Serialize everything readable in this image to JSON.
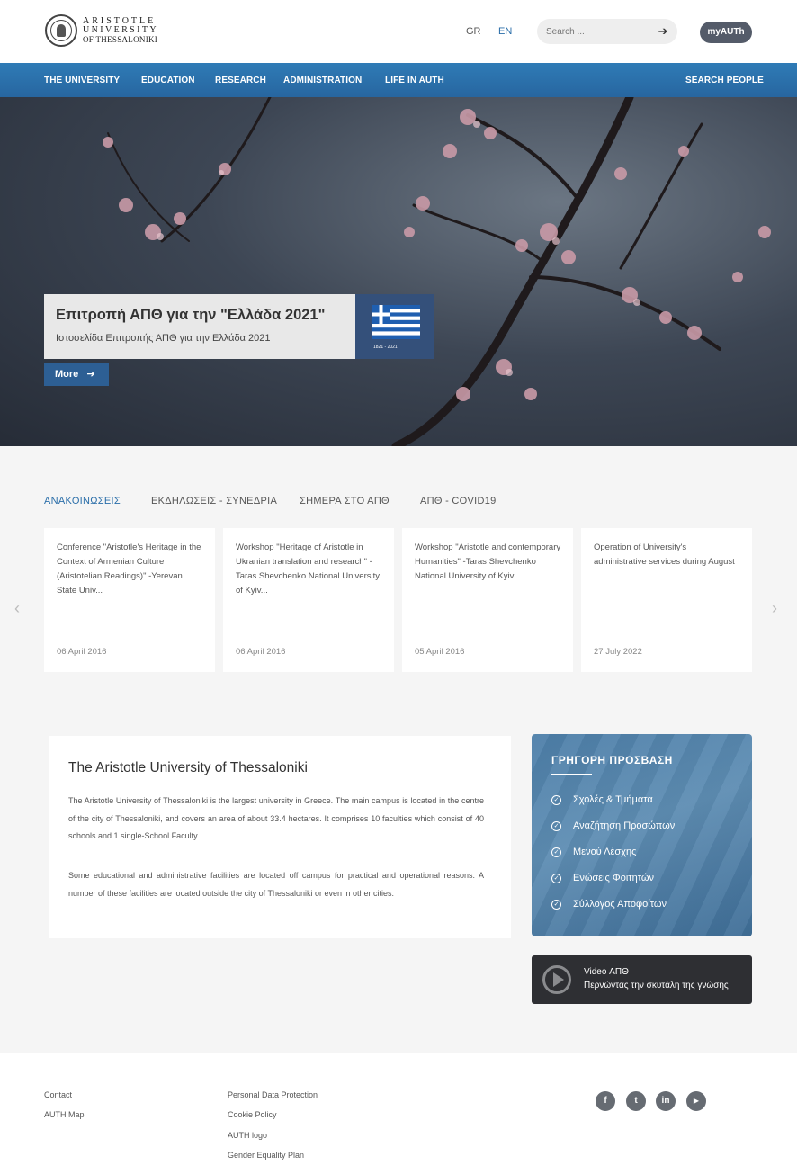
{
  "header": {
    "logo": {
      "line1": "ARISTOTLE",
      "line2": "UNIVERSITY",
      "line3": "OF THESSALONIKI"
    },
    "languages": [
      "GR",
      "EN"
    ],
    "search_placeholder": "Search ...",
    "myauth_label": "myAUTh"
  },
  "nav": {
    "items": [
      "THE UNIVERSITY",
      "EDUCATION",
      "RESEARCH",
      "ADMINISTRATION",
      "LIFE IN AUTH"
    ],
    "search_people": "SEARCH PEOPLE"
  },
  "hero": {
    "title": "Επιτροπή ΑΠΘ για την \"Ελλάδα 2021\"",
    "subtitle": "Ιστοσελίδα Επιτροπής ΑΠΘ για την Ελλάδα 2021",
    "more_label": "More",
    "flag_caption": "1821 - 2021"
  },
  "news": {
    "tabs": [
      "ΑΝΑΚΟΙΝΩΣΕΙΣ",
      "ΕΚΔΗΛΩΣΕΙΣ - ΣΥΝΕΔΡΙΑ",
      "ΣΗΜΕΡΑ ΣΤΟ ΑΠΘ",
      "ΑΠΘ - COVID19"
    ],
    "cards": [
      {
        "title": "Conference \"Aristotle's Heritage in the Context of Armenian Culture (Aristotelian Readings)\" -Yerevan State Univ...",
        "date": "06 April 2016"
      },
      {
        "title": "Workshop \"Heritage of Aristotle in Ukranian translation and research\" -Taras Shevchenko National University of Kyiv...",
        "date": "06 April 2016"
      },
      {
        "title": "Workshop \"Aristotle and contemporary Humanities\" -Taras Shevchenko National University of Kyiv",
        "date": "05 April 2016"
      },
      {
        "title": "Operation of University's administrative services during August",
        "date": "27 July 2022"
      }
    ],
    "prev_arrow": "‹",
    "next_arrow": "›"
  },
  "about": {
    "title": "The Aristotle University of Thessaloniki",
    "paragraph1": "The Aristotle University of Thessaloniki is the largest university in Greece. The main campus is located in the centre of the city of Thessaloniki, and covers an area of about 33.4 hectares. It comprises 10 faculties which consist of 40 schools and 1 single-School Faculty.",
    "paragraph2": "Some educational and administrative facilities are located off campus for practical and operational reasons. A number of these facilities are located outside the city of Thessaloniki or even in other cities."
  },
  "quick_access": {
    "title": "ΓΡΗΓΟΡΗ ΠΡΟΣΒΑΣΗ",
    "items": [
      "Σχολές & Τμήματα",
      "Αναζήτηση Προσώπων",
      "Μενού Λέσχης",
      "Ενώσεις Φοιτητών",
      "Σύλλογος Αποφοίτων"
    ]
  },
  "video": {
    "title": "Video ΑΠΘ",
    "subtitle": "Περνώντας την σκυτάλη της γνώσης"
  },
  "footer": {
    "col1": [
      "Contact",
      "AUTH Map"
    ],
    "col2": [
      "Personal Data Protection",
      "Cookie Policy",
      "AUTH logo",
      "Gender Equality Plan"
    ],
    "social": [
      {
        "icon": "facebook-icon",
        "glyph": "f"
      },
      {
        "icon": "twitter-icon",
        "glyph": "t"
      },
      {
        "icon": "linkedin-icon",
        "glyph": "in"
      },
      {
        "icon": "youtube-icon",
        "glyph": "▶"
      }
    ]
  },
  "colors": {
    "nav_blue": "#2f7bb6",
    "myauth_bg": "#545b69",
    "link_blue": "#2a6ea9",
    "quick_access_bg": "#5e8db3",
    "video_bg": "#2e2f33"
  }
}
